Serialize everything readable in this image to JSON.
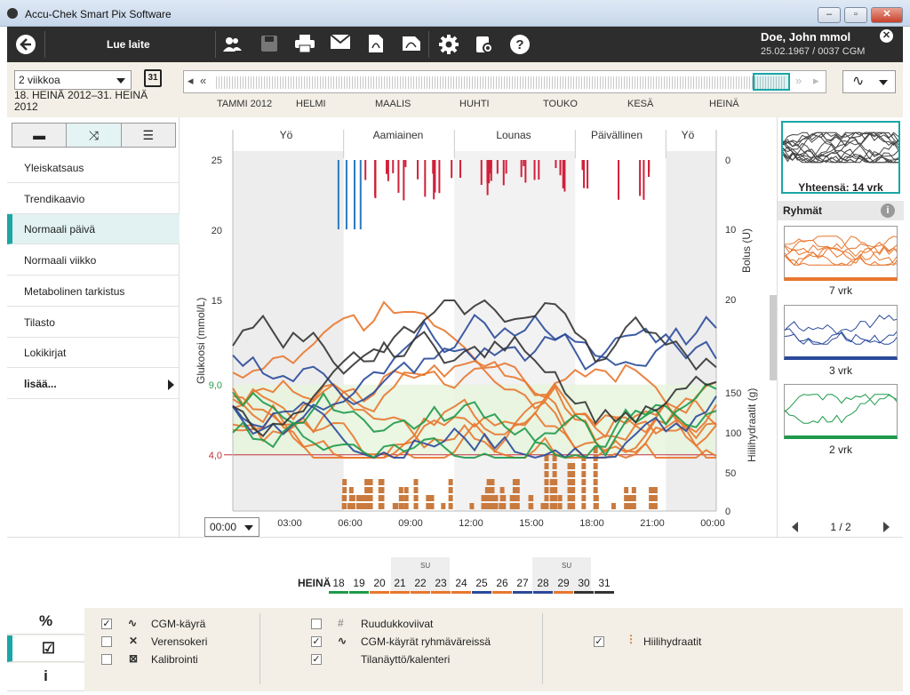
{
  "window": {
    "title": "Accu-Chek Smart Pix Software"
  },
  "toolbar": {
    "read_device": "Lue laite"
  },
  "patient": {
    "name": "Doe, John mmol",
    "info": "25.02.1967 / 0037 CGM"
  },
  "range": {
    "period_select": "2 viikkoa",
    "date_range": "18. HEINÄ 2012–31. HEINÄ 2012",
    "calendar_day": "31",
    "months": [
      "TAMMI 2012",
      "HELMI",
      "MAALIS",
      "HUHTI",
      "TOUKO",
      "KESÄ",
      "HEINÄ"
    ]
  },
  "nav": {
    "items": [
      "Yleiskatsaus",
      "Trendikaavio",
      "Normaali päivä",
      "Normaali viikko",
      "Metabolinen tarkistus",
      "Tilasto",
      "Lokikirjat"
    ],
    "active_index": 2,
    "more": "lisää..."
  },
  "chart": {
    "meals": [
      "Yö",
      "Aamiainen",
      "Lounas",
      "Päivällinen",
      "Yö"
    ],
    "ylabel_left": "Glukoosi (mmol/L)",
    "ylabel_right_bolus": "Bolus (U)",
    "ylabel_right_carbs": "Hiilihydraatit (g)",
    "time_select": "00:00"
  },
  "chart_data": {
    "type": "line",
    "x_ticks": [
      "03:00",
      "06:00",
      "09:00",
      "12:00",
      "15:00",
      "18:00",
      "21:00",
      "00:00"
    ],
    "y_ticks_glucose": [
      "25",
      "20",
      "15",
      "9,0",
      "4,0"
    ],
    "y_ticks_bolus": [
      "0",
      "10",
      "20"
    ],
    "y_ticks_carbs": [
      "150",
      "100",
      "50",
      "0"
    ],
    "ylim": [
      0,
      25
    ],
    "target_range": [
      4.0,
      9.0
    ],
    "hypo_line": 4.0,
    "series_colors": {
      "orange": "#e8772e",
      "blue": "#2a4a9a",
      "green": "#1e9a4a",
      "black": "#333333"
    }
  },
  "right": {
    "total_label": "Yhteensä: 14 vrk",
    "groups_header": "Ryhmät",
    "groups": [
      {
        "label": "7 vrk",
        "color": "#e8772e"
      },
      {
        "label": "3 vrk",
        "color": "#2a4a9a"
      },
      {
        "label": "2 vrk",
        "color": "#1e9a4a"
      }
    ],
    "pager": "1 / 2"
  },
  "days": {
    "month": "HEINÄ",
    "list": [
      {
        "d": "18",
        "c": "#1e9a4a"
      },
      {
        "d": "19",
        "c": "#1e9a4a"
      },
      {
        "d": "20",
        "c": "#e8772e"
      },
      {
        "d": "21",
        "c": "#e8772e"
      },
      {
        "d": "22",
        "c": "#e8772e"
      },
      {
        "d": "23",
        "c": "#e8772e"
      },
      {
        "d": "24",
        "c": "#e8772e"
      },
      {
        "d": "25",
        "c": "#2a4a9a"
      },
      {
        "d": "26",
        "c": "#e8772e"
      },
      {
        "d": "27",
        "c": "#2a4a9a"
      },
      {
        "d": "28",
        "c": "#2a4a9a"
      },
      {
        "d": "29",
        "c": "#e8772e"
      },
      {
        "d": "30",
        "c": "#333333"
      },
      {
        "d": "31",
        "c": "#333333"
      }
    ],
    "sunday_label": "SU"
  },
  "bottom": {
    "tabs": [
      "%",
      "☑",
      "i"
    ],
    "options": {
      "cgm_curve": "CGM-käyrä",
      "blood_glucose": "Verensokeri",
      "calibration": "Kalibrointi",
      "grid_lines": "Ruudukkoviivat",
      "cgm_group_colors": "CGM-käyrät ryhmäväreissä",
      "status_calendar": "Tilanäyttö/kalenteri",
      "carbs": "Hiilihydraatit"
    }
  }
}
